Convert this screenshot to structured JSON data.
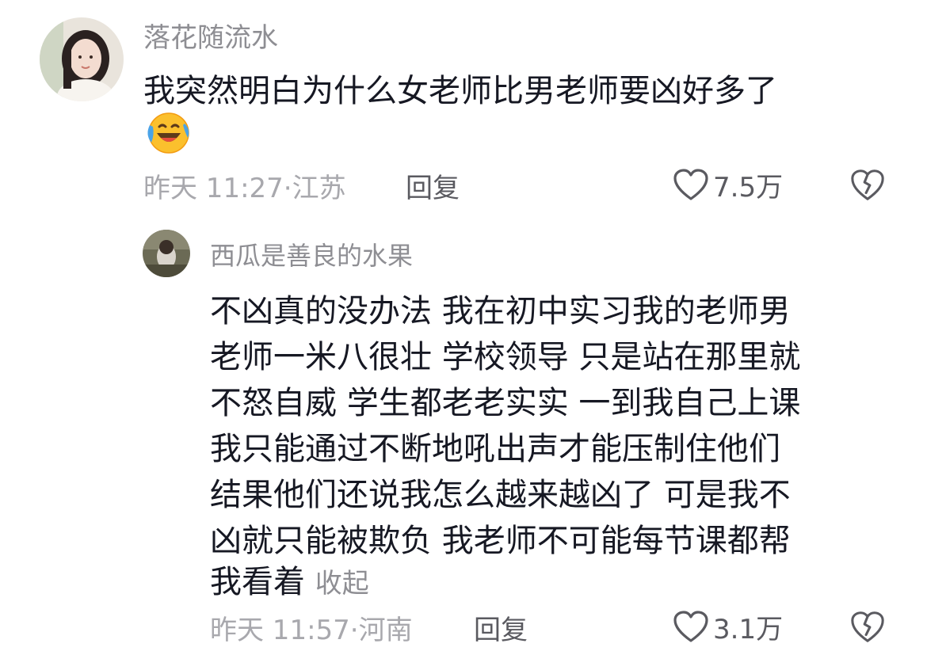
{
  "comments": [
    {
      "username": "落花随流水",
      "text": "我突然明白为什么女老师比男老师要凶好多了",
      "emoji": "laughing-crying-emoji",
      "time": "昨天 11:27",
      "separator": "·",
      "location": "江苏",
      "reply_label": "回复",
      "likes": "7.5万"
    }
  ],
  "reply": {
    "username": "西瓜是善良的水果",
    "lines": [
      "不凶真的没办法 我在初中实习我的老师男",
      "老师一米八很壮 学校领导 只是站在那里就",
      "不怒自威 学生都老老实实 一到我自己上课",
      "我只能通过不断地吼出声才能压制住他们",
      "结果他们还说我怎么越来越凶了 可是我不",
      "凶就只能被欺负 我老师不可能每节课都帮",
      "我看着"
    ],
    "collapse_label": "收起",
    "time": "昨天 11:57",
    "separator": "·",
    "location": "河南",
    "reply_label": "回复",
    "likes": "3.1万"
  },
  "icons": {
    "like": "heart-outline-icon",
    "dislike": "broken-heart-icon"
  },
  "colors": {
    "text_primary": "#161823",
    "text_secondary": "#8e8e93",
    "meta": "#a8a8ad",
    "action": "#5a5a60"
  }
}
